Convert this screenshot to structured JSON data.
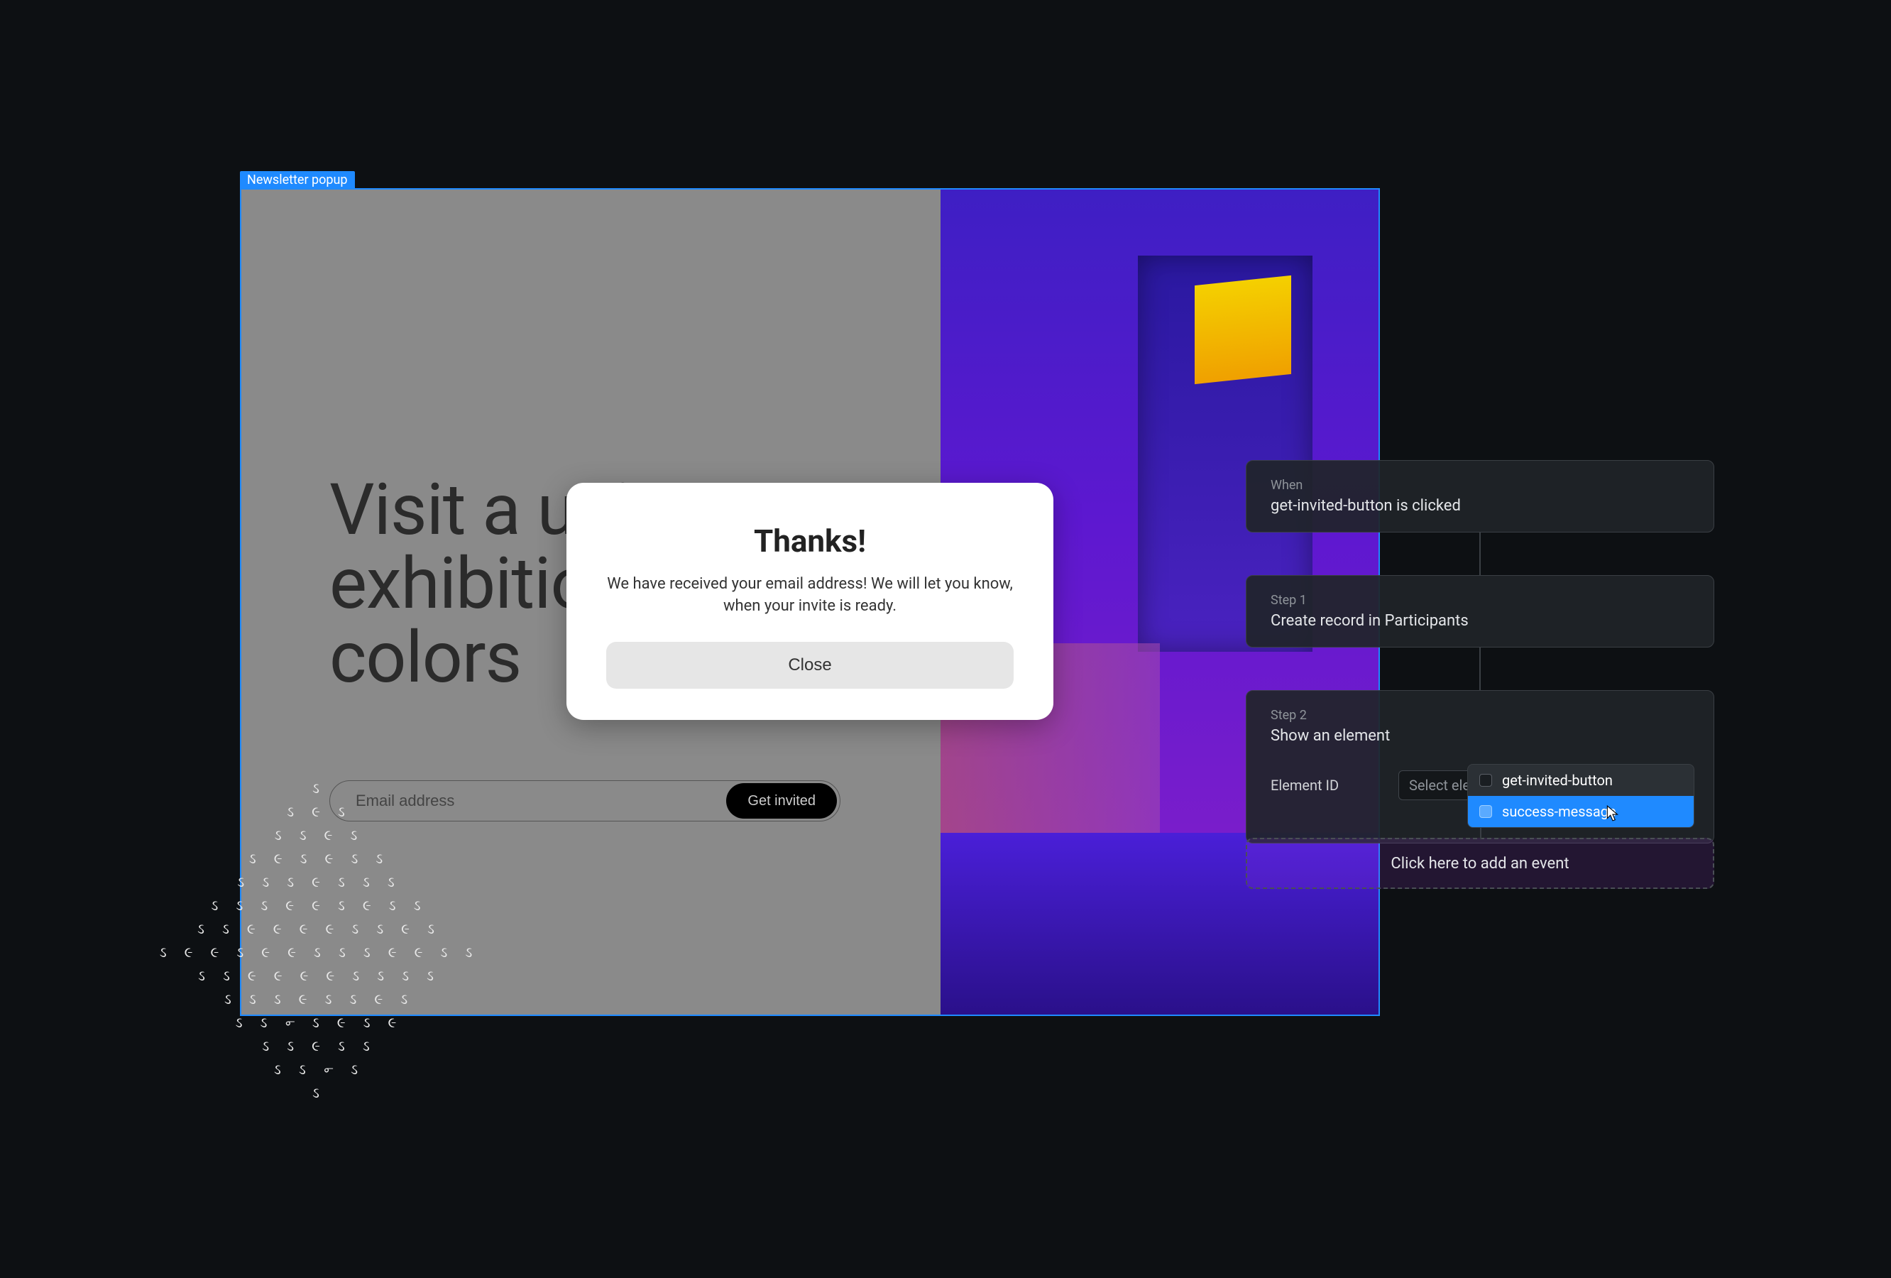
{
  "canvas": {
    "selection_label": "Newsletter popup"
  },
  "hero": {
    "title": "Visit a unique\nexhibition of\ncolors",
    "email_placeholder": "Email address",
    "cta_label": "Get invited"
  },
  "modal": {
    "title": "Thanks!",
    "body": "We have received your email address! We will let you know, when your invite is ready.",
    "close_label": "Close"
  },
  "workflow": {
    "when": {
      "label": "When",
      "value": "get-invited-button is clicked"
    },
    "steps": [
      {
        "label": "Step 1",
        "value": "Create record in Participants"
      },
      {
        "label": "Step 2",
        "value": "Show an element"
      }
    ],
    "element_field": {
      "label": "Element ID",
      "placeholder": "Select element ID",
      "hint": "Element"
    },
    "dropdown_options": [
      {
        "id": "get-invited-button",
        "label": "get-invited-button",
        "selected": false
      },
      {
        "id": "success-message",
        "label": "success-message",
        "selected": true
      }
    ],
    "add_event_label": "Click here to add an event"
  },
  "colors": {
    "selection_blue": "#1F8AFF",
    "dark_bg": "#0d1013"
  }
}
